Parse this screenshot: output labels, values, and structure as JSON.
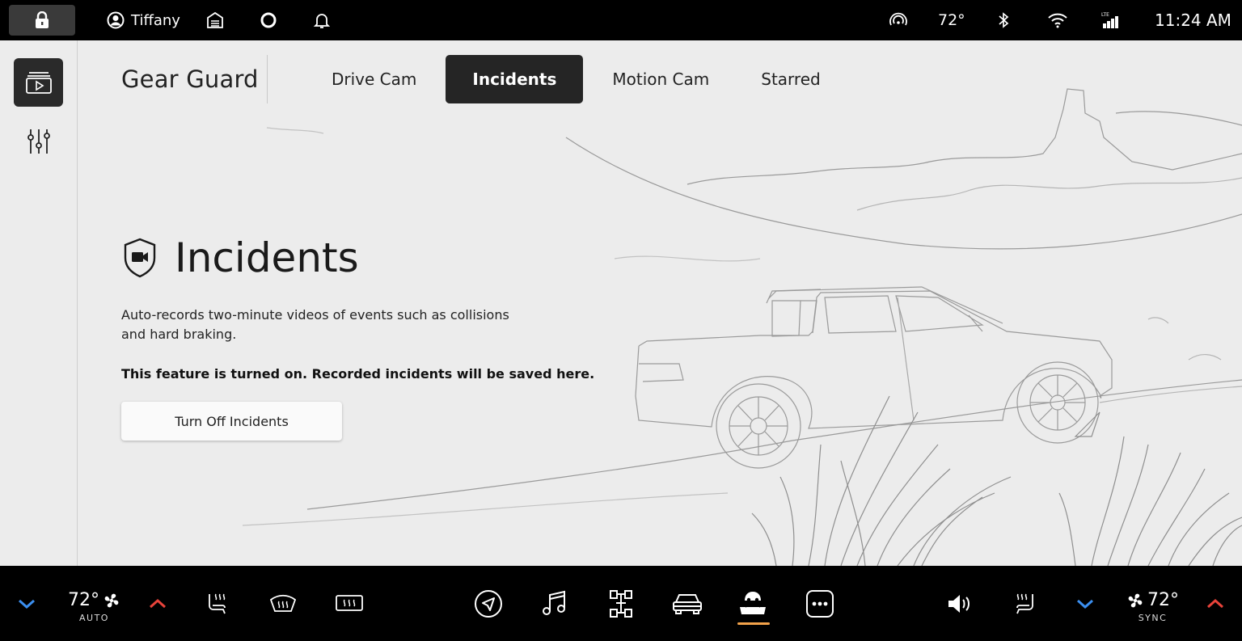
{
  "status_bar": {
    "user_name": "Tiffany",
    "temperature": "72°",
    "time": "11:24 AM",
    "network": "LTE"
  },
  "header": {
    "title": "Gear Guard",
    "tabs": [
      {
        "label": "Drive Cam",
        "active": false
      },
      {
        "label": "Incidents",
        "active": true
      },
      {
        "label": "Motion Cam",
        "active": false
      },
      {
        "label": "Starred",
        "active": false
      }
    ]
  },
  "content": {
    "title": "Incidents",
    "description": "Auto-records two-minute videos of events such as collisions and hard braking.",
    "status_note": "This feature is turned on. Recorded incidents will be saved here.",
    "button_label": "Turn Off Incidents"
  },
  "climate": {
    "left_temp": "72°",
    "left_mode": "AUTO",
    "right_temp": "72°",
    "right_mode": "SYNC"
  },
  "colors": {
    "accent_active": "#f2a24a",
    "temp_down": "#3b8ff0",
    "temp_up": "#e8433a",
    "tab_active_bg": "#252525"
  },
  "icons": {
    "status": [
      "lock-icon",
      "user-icon",
      "garage-icon",
      "alexa-icon",
      "bell-icon",
      "hotspot-icon",
      "bluetooth-icon",
      "wifi-icon",
      "cellular-signal-icon"
    ],
    "rail": [
      "camera-library-icon",
      "sliders-icon"
    ],
    "dock": [
      "navigation-icon",
      "music-icon",
      "drive-modes-icon",
      "vehicle-icon",
      "gear-guard-icon",
      "more-icon"
    ]
  }
}
